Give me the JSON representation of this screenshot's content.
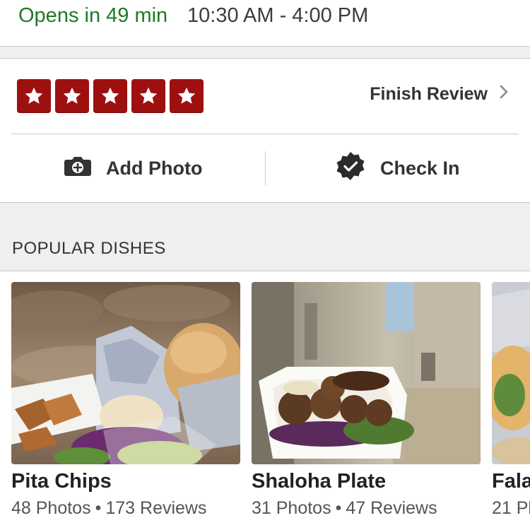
{
  "hours": {
    "status": "Opens in 49 min",
    "range": "10:30 AM - 4:00 PM",
    "status_color": "#1f7a27"
  },
  "review": {
    "rating_stars": 5,
    "star_color": "#9e1010",
    "finish_label": "Finish Review",
    "chevron_icon": "chevron-right-icon"
  },
  "actions": {
    "add_photo": {
      "label": "Add Photo",
      "icon": "camera-icon"
    },
    "check_in": {
      "label": "Check In",
      "icon": "check-badge-icon"
    }
  },
  "popular": {
    "title": "POPULAR DISHES",
    "dishes": [
      {
        "name": "Pita Chips",
        "photos": "48 Photos",
        "reviews": "173 Reviews"
      },
      {
        "name": "Shaloha Plate",
        "photos": "31 Photos",
        "reviews": "47 Reviews"
      },
      {
        "name": "Fala",
        "photos": "21 Pl",
        "reviews": ""
      }
    ]
  }
}
